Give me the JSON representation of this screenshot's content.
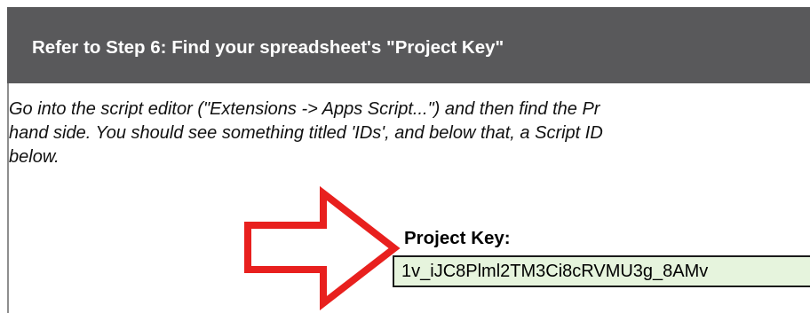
{
  "header": {
    "title": "Refer to Step 6: Find your spreadsheet's \"Project Key\""
  },
  "instructions": {
    "line1": "Go into the script editor (\"Extensions -> Apps Script...\") and then find the Pr",
    "line2": "hand side. You should see something titled 'IDs', and below that, a Script ID",
    "line3": "below."
  },
  "project_key": {
    "label": "Project Key:",
    "value": "1v_iJC8Plml2TM3Ci8cRVMU3g_8AMv"
  },
  "colors": {
    "header_bg": "#59595b",
    "arrow_outline": "#e8201e",
    "key_field_bg": "#e6f4dd"
  },
  "icons": {
    "arrow": "right-arrow-icon"
  }
}
